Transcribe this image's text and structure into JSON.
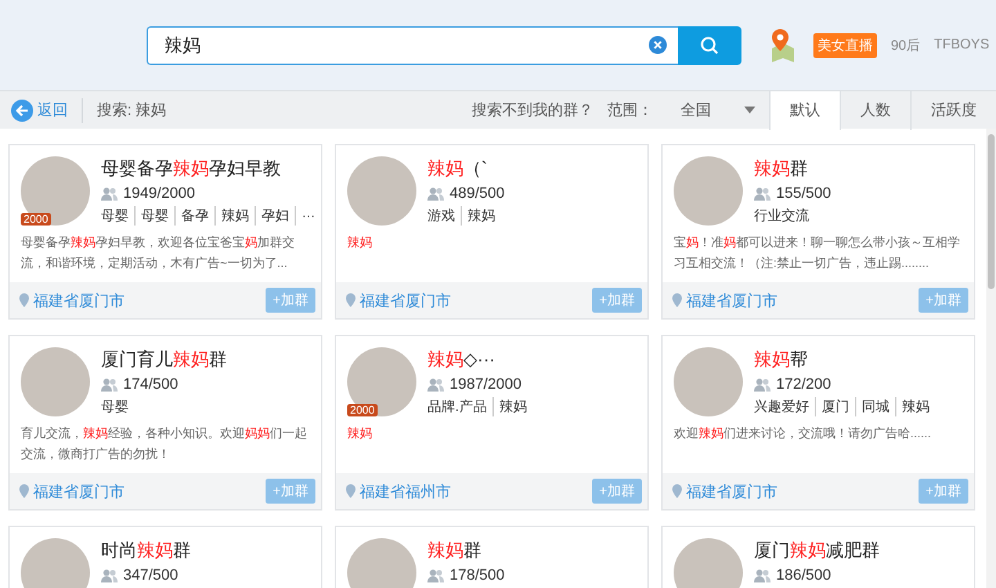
{
  "search": {
    "value": "辣妈"
  },
  "header_links": [
    {
      "kind": "badge",
      "label": "美女直播"
    },
    {
      "kind": "link",
      "label": "90后"
    },
    {
      "kind": "link",
      "label": "TFBOYS"
    }
  ],
  "toolbar": {
    "back": "返回",
    "query": "搜索: 辣妈",
    "help": "搜索不到我的群？",
    "range_label": "范围：",
    "range_value": "全国"
  },
  "sort_tabs": [
    {
      "label": "默认",
      "selected": true
    },
    {
      "label": "人数",
      "selected": false
    },
    {
      "label": "活跃度",
      "selected": false
    }
  ],
  "groups": [
    {
      "name": [
        {
          "text": "母婴备孕",
          "hit": false
        },
        {
          "text": "辣妈",
          "hit": true
        },
        {
          "text": "孕妇早教",
          "hit": false
        }
      ],
      "badge": "2000",
      "members": "1949/2000",
      "tags": [
        "母婴",
        "母婴",
        "备孕",
        "辣妈",
        "孕妇",
        "…"
      ],
      "description": [
        {
          "text": "母婴备孕",
          "hit": false
        },
        {
          "text": "辣妈",
          "hit": true
        },
        {
          "text": "孕妇早教，欢迎各位宝爸宝",
          "hit": false
        },
        {
          "text": "妈",
          "hit": true
        },
        {
          "text": "加群交流，和谐环境，定期活动，木有广告~一切为了...",
          "hit": false
        }
      ],
      "location": "福建省厦门市",
      "join": "+加群"
    },
    {
      "name": [
        {
          "text": "辣妈",
          "hit": true
        },
        {
          "text": "（`",
          "hit": false
        }
      ],
      "members": "489/500",
      "tags": [
        "游戏",
        "辣妈"
      ],
      "description": [
        {
          "text": "辣妈",
          "hit": true
        }
      ],
      "location": "福建省厦门市",
      "join": "+加群"
    },
    {
      "name": [
        {
          "text": "辣妈",
          "hit": true
        },
        {
          "text": "群",
          "hit": false
        }
      ],
      "members": "155/500",
      "tags": [
        "行业交流"
      ],
      "description": [
        {
          "text": "宝",
          "hit": false
        },
        {
          "text": "妈",
          "hit": true
        },
        {
          "text": "！准",
          "hit": false
        },
        {
          "text": "妈",
          "hit": true
        },
        {
          "text": "都可以进来！聊一聊怎么带小孩～互相学习互相交流！（注:禁止一切广告，违止踢........",
          "hit": false
        }
      ],
      "location": "福建省厦门市",
      "join": "+加群"
    },
    {
      "name": [
        {
          "text": "厦门育儿",
          "hit": false
        },
        {
          "text": "辣妈",
          "hit": true
        },
        {
          "text": "群",
          "hit": false
        }
      ],
      "members": "174/500",
      "tags": [
        "母婴"
      ],
      "description": [
        {
          "text": "育儿交流，",
          "hit": false
        },
        {
          "text": "辣妈",
          "hit": true
        },
        {
          "text": "经验，各种小知识。欢迎",
          "hit": false
        },
        {
          "text": "妈妈",
          "hit": true
        },
        {
          "text": "们一起交流，微商打广告的勿扰！",
          "hit": false
        }
      ],
      "location": "福建省厦门市",
      "join": "+加群"
    },
    {
      "name": [
        {
          "text": "辣妈",
          "hit": true
        },
        {
          "text": "◇···",
          "hit": false
        }
      ],
      "badge": "2000",
      "members": "1987/2000",
      "tags": [
        "品牌.产品",
        "辣妈"
      ],
      "description": [
        {
          "text": "辣妈",
          "hit": true
        }
      ],
      "location": "福建省福州市",
      "join": "+加群"
    },
    {
      "name": [
        {
          "text": "辣妈",
          "hit": true
        },
        {
          "text": "帮",
          "hit": false
        }
      ],
      "members": "172/200",
      "tags": [
        "兴趣爱好",
        "厦门",
        "同城",
        "辣妈"
      ],
      "description": [
        {
          "text": "欢迎",
          "hit": false
        },
        {
          "text": "辣妈",
          "hit": true
        },
        {
          "text": "们进来讨论，交流哦！请勿广告哈......",
          "hit": false
        }
      ],
      "location": "福建省厦门市",
      "join": "+加群"
    },
    {
      "name": [
        {
          "text": "时尚",
          "hit": false
        },
        {
          "text": "辣妈",
          "hit": true
        },
        {
          "text": "群",
          "hit": false
        }
      ],
      "members": "347/500"
    },
    {
      "name": [
        {
          "text": "辣妈",
          "hit": true
        },
        {
          "text": "群",
          "hit": false
        }
      ],
      "members": "178/500"
    },
    {
      "name": [
        {
          "text": "厦门",
          "hit": false
        },
        {
          "text": "辣妈",
          "hit": true
        },
        {
          "text": "减肥群",
          "hit": false
        }
      ],
      "members": "186/500"
    }
  ]
}
